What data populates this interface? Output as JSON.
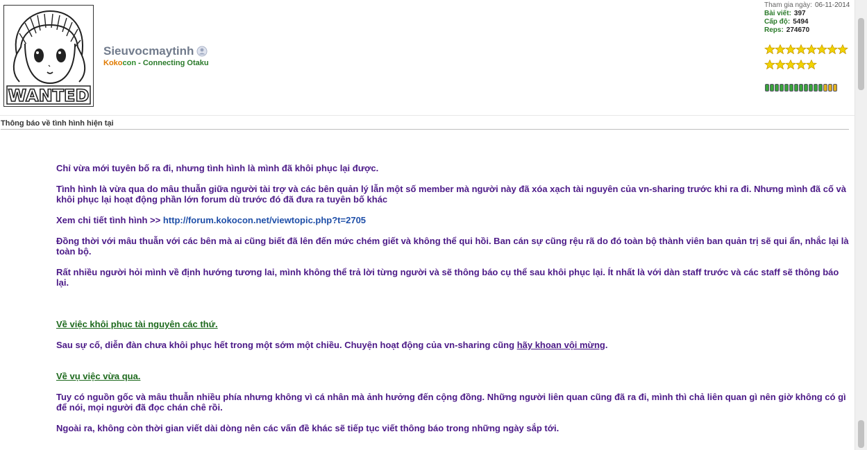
{
  "author": {
    "avatar_text": "WANTED",
    "username": "Sieuvocmaytinh",
    "tagline_k1": "Koko",
    "tagline_k2": "con",
    "tagline_rest": " - Connecting Otaku"
  },
  "profile": {
    "joined_label": "Tham gia ngày:",
    "joined_value": "06-11-2014",
    "posts_label": "Bài viết:",
    "posts_value": "397",
    "level_label": "Cấp độ:",
    "level_value": "5494",
    "reps_label": "Reps:",
    "reps_value": "274670",
    "star_count": 13,
    "rep_level": 0.8
  },
  "post": {
    "title": "Thông báo về tình hình hiện tại",
    "p1": "Chỉ vừa mới tuyên bố ra đi, nhưng tình hình là mình đã khôi phục lại được.",
    "p2": "Tình hình là vừa qua do mâu thuẫn giữa người tài trợ và các bên quản lý lẫn một số member mà người này đã xóa xạch tài nguyên của vn-sharing trước khi ra đi. Nhưng mình đã cố và khôi phục lại hoạt động phần lớn forum dù trước đó đã đưa ra tuyên bố khác",
    "p3_label": "Xem chi tiết tình hình >> ",
    "p3_link": "http://forum.kokocon.net/viewtopic.php?t=2705",
    "p4": "Đồng thời với mâu thuẫn với các bên mà ai cũng biết đã lên đến mức chém giết và không thể qui hồi. Ban cán sự cũng rệu rã do đó toàn bộ thành viên ban quản trị sẽ qui ẩn, nhắc lại là toàn bộ.",
    "p5": "Rất nhiều người hỏi mình về định hướng tương lai, mình không thể trả lời từng người và sẽ thông báo cụ thể sau khôi phục lại. Ít nhất là với dàn staff trước và các staff sẽ thông báo lại.",
    "h1": "Về việc khôi phục tài nguyên các thứ.",
    "p6_a": "Sau sự cố, diễn đàn chưa khôi phục hết trong một sớm một chiều. Chuyện hoạt động của vn-sharing cũng ",
    "p6_b": "hãy khoan vội mừng",
    "p6_c": ".",
    "h2": "Về vụ việc vừa qua.",
    "p7": "Tuy có nguồn gốc và mâu thuẫn nhiều phía nhưng không vì cá nhân mà ảnh hưởng đến cộng đồng. Những người liên quan cũng đã ra đi, mình thì chả liên quan gì nên giờ không có gì để nói, mọi người đã đọc chán chê rồi.",
    "p8": "Ngoài ra, không còn thời gian viết dài dòng nên các vấn đề khác sẽ tiếp tục viết thông báo trong những ngày sắp tới."
  },
  "colors": {
    "post_text": "#4b1987",
    "section_heading": "#1e6a1e",
    "link": "#1f4fa8",
    "username": "#717b8c"
  },
  "icons": [
    "online-status-icon",
    "star-icon"
  ]
}
